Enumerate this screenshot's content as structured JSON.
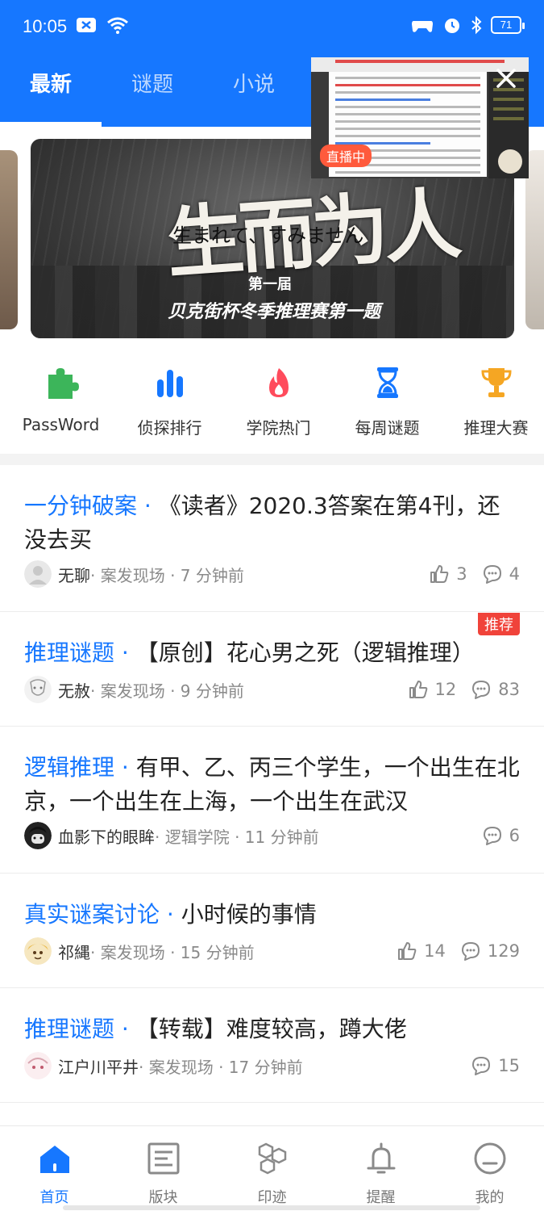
{
  "status": {
    "time": "10:05",
    "battery": "71"
  },
  "top_tabs": [
    {
      "label": "最新"
    },
    {
      "label": "谜题"
    },
    {
      "label": "小说"
    }
  ],
  "live": {
    "badge": "直播中"
  },
  "banner": {
    "big": "生而为人",
    "sub": "生まれて、すみません",
    "line1": "第一届",
    "line2": "贝克街杯冬季推理赛第一题"
  },
  "quick_nav": [
    {
      "label": "PassWord",
      "icon": "puzzle-icon",
      "color": "#3cb55a"
    },
    {
      "label": "侦探排行",
      "icon": "bar-chart-icon",
      "color": "#1677ff"
    },
    {
      "label": "学院热门",
      "icon": "flame-icon",
      "color": "#ff4b5c"
    },
    {
      "label": "每周谜题",
      "icon": "hourglass-icon",
      "color": "#1677ff"
    },
    {
      "label": "推理大赛",
      "icon": "trophy-icon",
      "color": "#f5a623"
    }
  ],
  "posts": [
    {
      "category": "一分钟破案 · ",
      "title": "《读者》2020.3答案在第4刊，还没去买",
      "author": "无聊",
      "meta": " · 案发现场 · 7 分钟前",
      "likes": "3",
      "comments": "4"
    },
    {
      "category": "推理谜题 · ",
      "title": "【原创】花心男之死（逻辑推理）",
      "author": "无赦",
      "meta": " · 案发现场 · 9 分钟前",
      "likes": "12",
      "comments": "83",
      "tag": "推荐"
    },
    {
      "category": "逻辑推理 · ",
      "title": "有甲、乙、丙三个学生，一个出生在北京，一个出生在上海，一个出生在武汉",
      "author": "血影下的眼眸",
      "meta": " · 逻辑学院 · 11 分钟前",
      "comments": "6"
    },
    {
      "category": "真实谜案讨论 · ",
      "title": "小时候的事情",
      "author": "祁縄",
      "meta": " · 案发现场 · 15 分钟前",
      "likes": "14",
      "comments": "129"
    },
    {
      "category": "推理谜题 · ",
      "title": "【转载】难度较高，蹲大佬",
      "author": "江户川平井",
      "meta": " · 案发现场 · 17 分钟前",
      "comments": "15"
    }
  ],
  "bottom_nav": [
    {
      "label": "首页",
      "icon": "home-icon"
    },
    {
      "label": "版块",
      "icon": "board-icon"
    },
    {
      "label": "印迹",
      "icon": "hexagon-icon"
    },
    {
      "label": "提醒",
      "icon": "bell-icon"
    },
    {
      "label": "我的",
      "icon": "profile-icon"
    }
  ],
  "colors": {
    "brand": "#1677ff",
    "tag": "#f0433a"
  }
}
